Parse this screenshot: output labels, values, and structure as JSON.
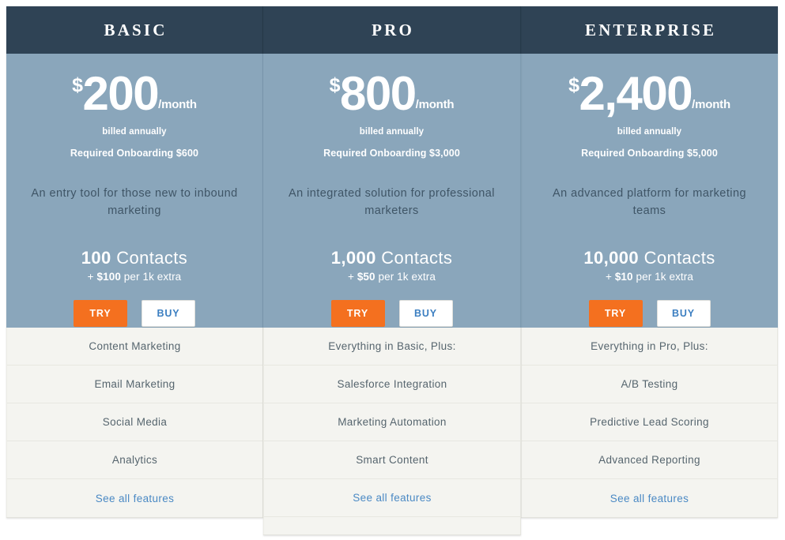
{
  "brand": {
    "header_bg": "#2f4355",
    "panel_bg": "#8aa6bb",
    "feature_bg": "#f4f4f0",
    "try_color": "#f4701f",
    "buy_text_color": "#3c7fc1",
    "link_color": "#4a89c4"
  },
  "plans": [
    {
      "name": "BASIC",
      "currency": "$",
      "amount": "200",
      "period": "/month",
      "billing_note": "billed annually",
      "onboarding": "Required Onboarding $600",
      "tagline": "An entry tool for those new to inbound marketing",
      "contacts_count": "100",
      "contacts_word": "Contacts",
      "extra_prefix": "+ ",
      "extra_price": "$100",
      "extra_suffix": " per 1k extra",
      "try_label": "TRY",
      "buy_label": "BUY",
      "features": [
        "Content Marketing",
        "Email Marketing",
        "Social Media",
        "Analytics"
      ],
      "see_all_label": "See all features"
    },
    {
      "name": "PRO",
      "currency": "$",
      "amount": "800",
      "period": "/month",
      "billing_note": "billed annually",
      "onboarding": "Required Onboarding $3,000",
      "tagline": "An integrated solution for professional marketers",
      "contacts_count": "1,000",
      "contacts_word": "Contacts",
      "extra_prefix": "+ ",
      "extra_price": "$50",
      "extra_suffix": " per 1k extra",
      "try_label": "TRY",
      "buy_label": "BUY",
      "features": [
        "Everything in Basic, Plus:",
        "Salesforce Integration",
        "Marketing Automation",
        "Smart Content"
      ],
      "see_all_label": "See all features"
    },
    {
      "name": "ENTERPRISE",
      "currency": "$",
      "amount": "2,400",
      "period": "/month",
      "billing_note": "billed annually",
      "onboarding": "Required Onboarding $5,000",
      "tagline": "An advanced platform for marketing teams",
      "contacts_count": "10,000",
      "contacts_word": "Contacts",
      "extra_prefix": "+ ",
      "extra_price": "$10",
      "extra_suffix": " per 1k extra",
      "try_label": "TRY",
      "buy_label": "BUY",
      "features": [
        "Everything in Pro, Plus:",
        "A/B Testing",
        "Predictive Lead Scoring",
        "Advanced Reporting"
      ],
      "see_all_label": "See all features"
    }
  ]
}
